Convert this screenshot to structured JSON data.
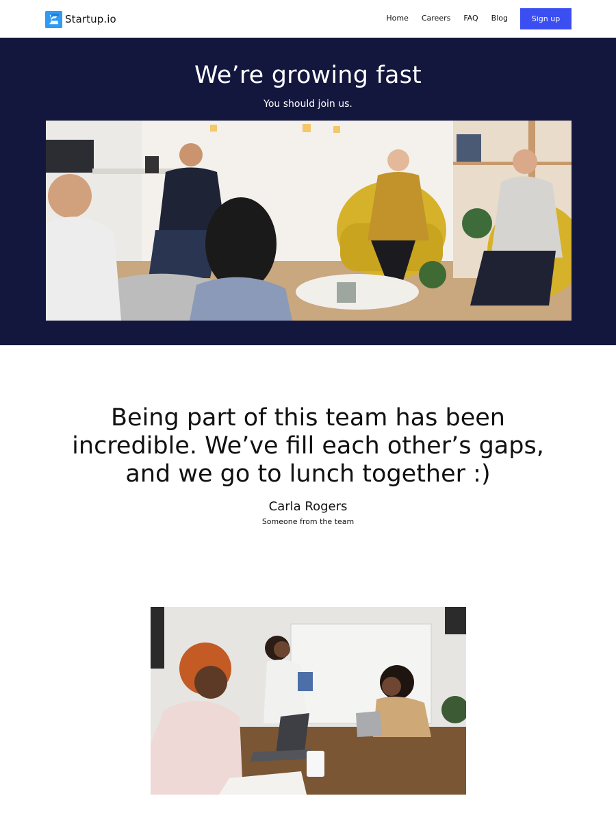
{
  "nav": {
    "brand": "Startup.io",
    "links": [
      "Home",
      "Careers",
      "FAQ",
      "Blog"
    ],
    "signup_label": "Sign up"
  },
  "hero": {
    "title": "We’re growing fast",
    "subtitle": "You should join us."
  },
  "testimonial": {
    "quote": "Being part of this team has been incredible. We’ve fill each other’s gaps, and we go to lunch together :)",
    "author": "Carla Rogers",
    "role": "Someone from the team"
  },
  "colors": {
    "hero_bg": "#13173e",
    "button_bg": "#3b4ef2",
    "logo": "#2f9bf5"
  },
  "icons": [
    "startup-logo-icon"
  ]
}
